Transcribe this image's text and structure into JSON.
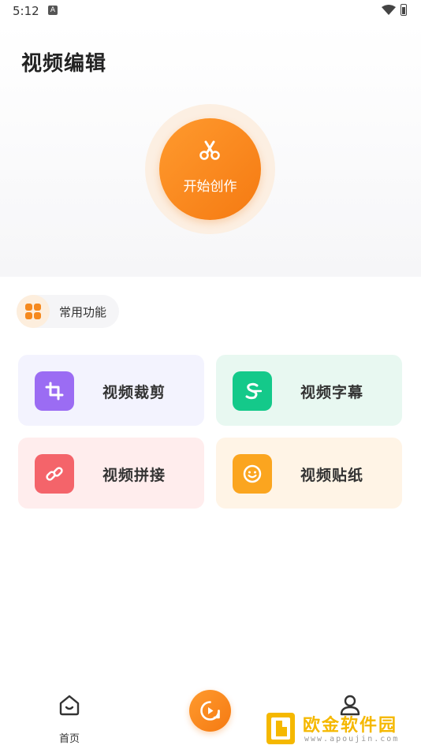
{
  "status_bar": {
    "time": "5:12",
    "notification_letter": "A"
  },
  "page": {
    "title": "视频编辑"
  },
  "create": {
    "label": "开始创作",
    "icon": "scissors-icon"
  },
  "common": {
    "label": "常用功能",
    "icon": "grid-icon"
  },
  "features": [
    {
      "label": "视频裁剪",
      "icon": "crop-icon",
      "card_bg": "#f3f3fe",
      "icon_bg": "#9b6cf3"
    },
    {
      "label": "视频字幕",
      "icon": "subtitle-s-icon",
      "card_bg": "#e8f8f1",
      "icon_bg": "#14c98a"
    },
    {
      "label": "视频拼接",
      "icon": "link-icon",
      "card_bg": "#ffeded",
      "icon_bg": "#f4646a"
    },
    {
      "label": "视频贴纸",
      "icon": "smiley-icon",
      "card_bg": "#fff4e6",
      "icon_bg": "#fba51f"
    }
  ],
  "bottom_nav": {
    "home_label": "首页",
    "center_icon": "video-play-icon",
    "profile_icon": "user-icon"
  },
  "watermark": {
    "text": "欧金软件园",
    "url": "www.apoujin.com"
  },
  "colors": {
    "accent": "#f5891e",
    "text": "#222222"
  }
}
